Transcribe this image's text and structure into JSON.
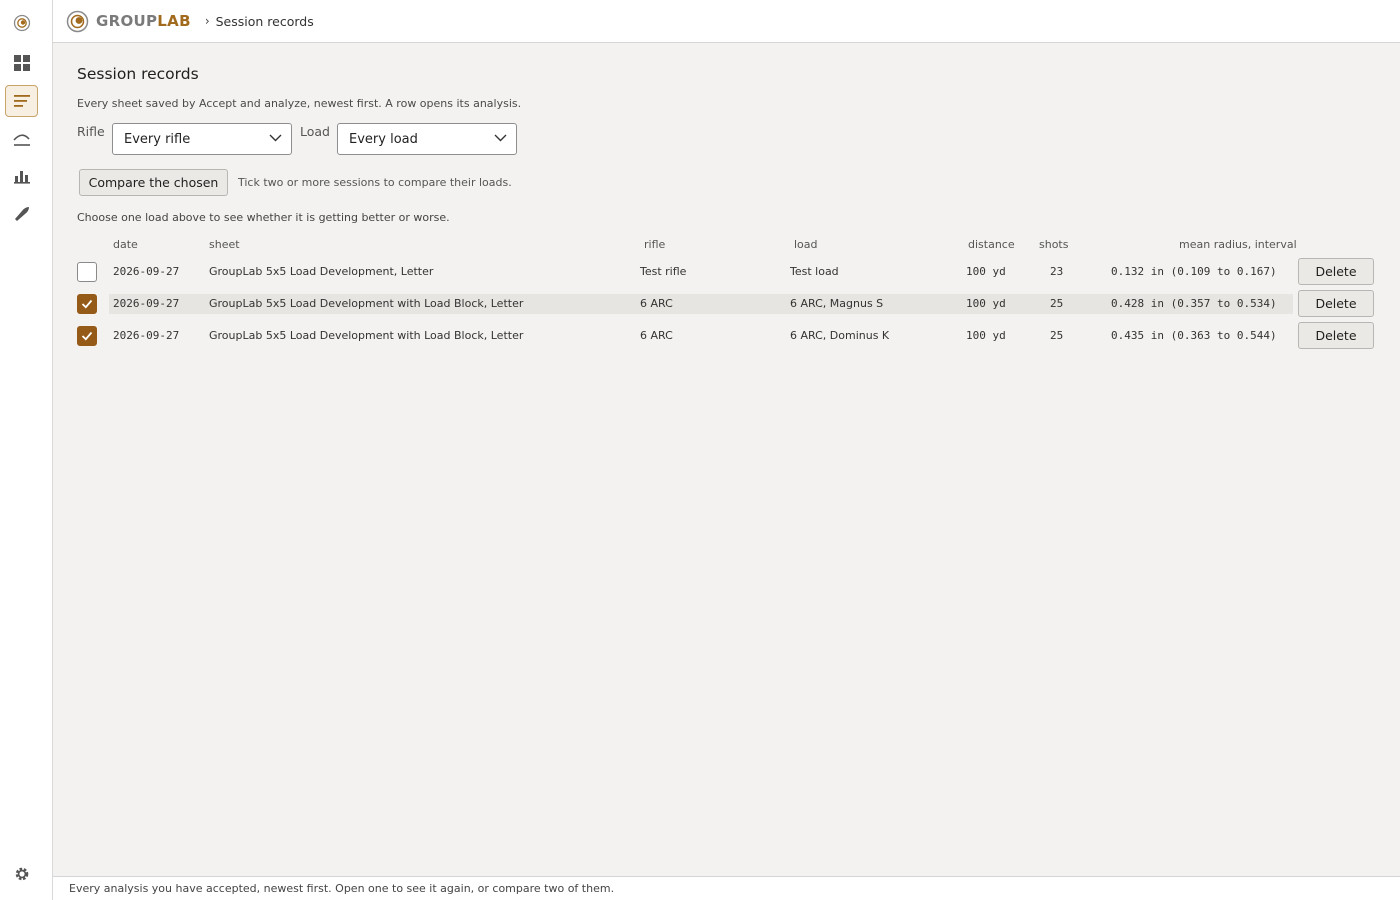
{
  "app": {
    "brand_prefix": "GROUP",
    "brand_suffix": "LAB",
    "breadcrumb_sep": "›",
    "breadcrumb": "Session records"
  },
  "colors": {
    "accent": "#955a17",
    "brand": "#a16a1c",
    "background": "#f3f2f0"
  },
  "sidebar": {
    "items": [
      {
        "icon": "target-logo-icon"
      },
      {
        "icon": "dashboard-icon"
      },
      {
        "icon": "session-records-icon",
        "active": true
      },
      {
        "icon": "trajectory-icon"
      },
      {
        "icon": "bar-chart-icon"
      },
      {
        "icon": "bullet-icon"
      },
      {
        "icon": "gear-icon"
      }
    ]
  },
  "page": {
    "title": "Session records",
    "intro": "Every sheet saved by Accept and analyze, newest first. A row opens its analysis.",
    "filters": {
      "rifle_label": "Rifle",
      "rifle_value": "Every rifle",
      "load_label": "Load",
      "load_value": "Every load"
    },
    "compare_button": "Compare the chosen",
    "compare_hint": "Tick two or more sessions to compare their loads.",
    "trend_hint": "Choose one load above to see whether it is getting better or worse."
  },
  "table": {
    "headers": {
      "date": "date",
      "sheet": "sheet",
      "rifle": "rifle",
      "load": "load",
      "distance": "distance",
      "shots": "shots",
      "mean_radius": "mean radius, interval"
    },
    "rows": [
      {
        "checked": false,
        "date": "2026-09-27",
        "sheet": "GroupLab 5x5 Load Development, Letter",
        "rifle": "Test rifle",
        "load": "Test load",
        "distance": "100 yd",
        "shots": "23",
        "mean_radius": "0.132 in (0.109 to 0.167)",
        "delete": "Delete"
      },
      {
        "checked": true,
        "date": "2026-09-27",
        "sheet": "GroupLab 5x5 Load Development with Load Block, Letter",
        "rifle": "6 ARC",
        "load": "6 ARC, Magnus S",
        "distance": "100 yd",
        "shots": "25",
        "mean_radius": "0.428 in (0.357 to 0.534)",
        "delete": "Delete"
      },
      {
        "checked": true,
        "date": "2026-09-27",
        "sheet": "GroupLab 5x5 Load Development with Load Block, Letter",
        "rifle": "6 ARC",
        "load": "6 ARC, Dominus K",
        "distance": "100 yd",
        "shots": "25",
        "mean_radius": "0.435 in (0.363 to 0.544)",
        "delete": "Delete"
      }
    ]
  },
  "footer": {
    "text": "Every analysis you have accepted, newest first. Open one to see it again, or compare two of them."
  }
}
